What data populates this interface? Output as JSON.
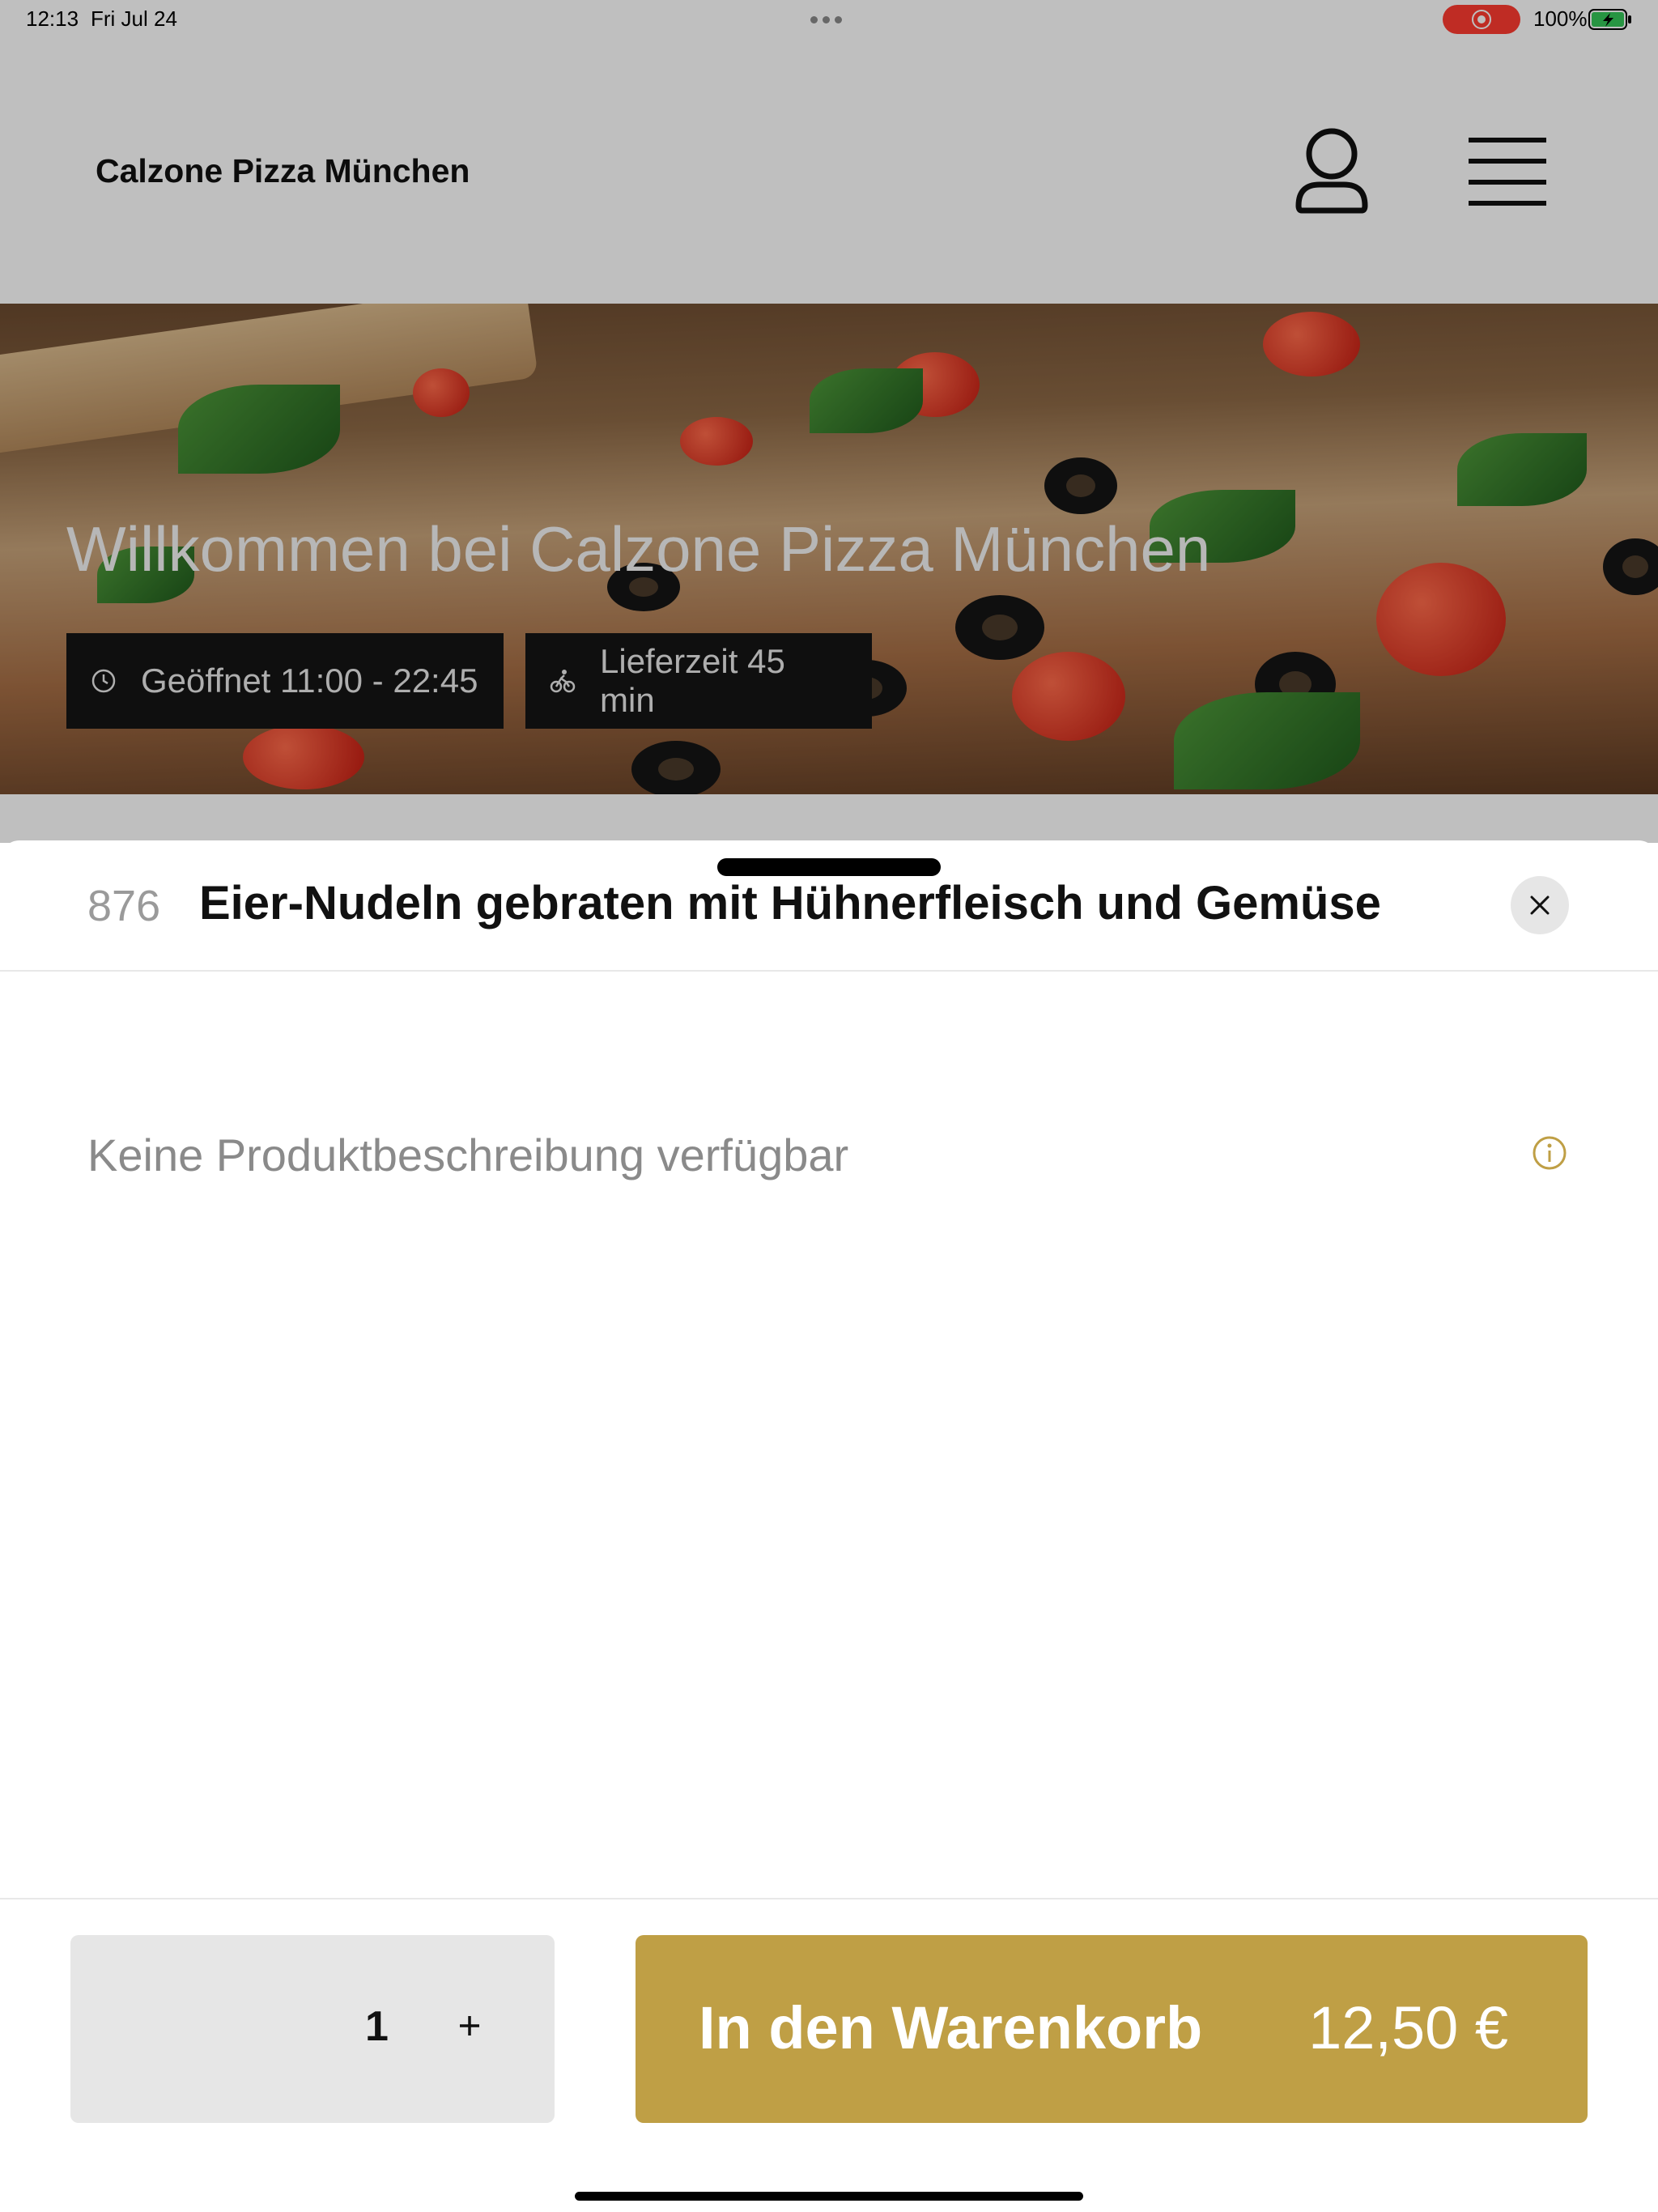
{
  "status_bar": {
    "time": "12:13",
    "date": "Fri Jul 24",
    "battery": "100%",
    "icons": [
      "multitask-dots-icon",
      "screen-record-icon",
      "battery-charging-icon"
    ]
  },
  "header": {
    "title": "Calzone Pizza München",
    "icons": [
      "user-icon",
      "hamburger-menu-icon"
    ]
  },
  "hero": {
    "title": "Willkommen bei Calzone Pizza München",
    "opening_hours": "Geöffnet 11:00 - 22:45",
    "delivery_time": "Lieferzeit 45 min",
    "icons": [
      "clock-icon",
      "bicycle-icon"
    ]
  },
  "sheet": {
    "item_number": "876",
    "item_title": "Eier-Nudeln gebraten mit Hühnerfleisch und Gemüse",
    "description": "Keine Produktbeschreibung verfügbar",
    "quantity": "1",
    "add_to_cart_label": "In den Warenkorb",
    "price": "12,50 €",
    "icons": [
      "close-icon",
      "info-icon",
      "plus-icon"
    ]
  },
  "colors": {
    "accent": "#bf9f45",
    "badge_bg": "#141414",
    "record": "#ff3b30",
    "battery": "#34c759"
  }
}
